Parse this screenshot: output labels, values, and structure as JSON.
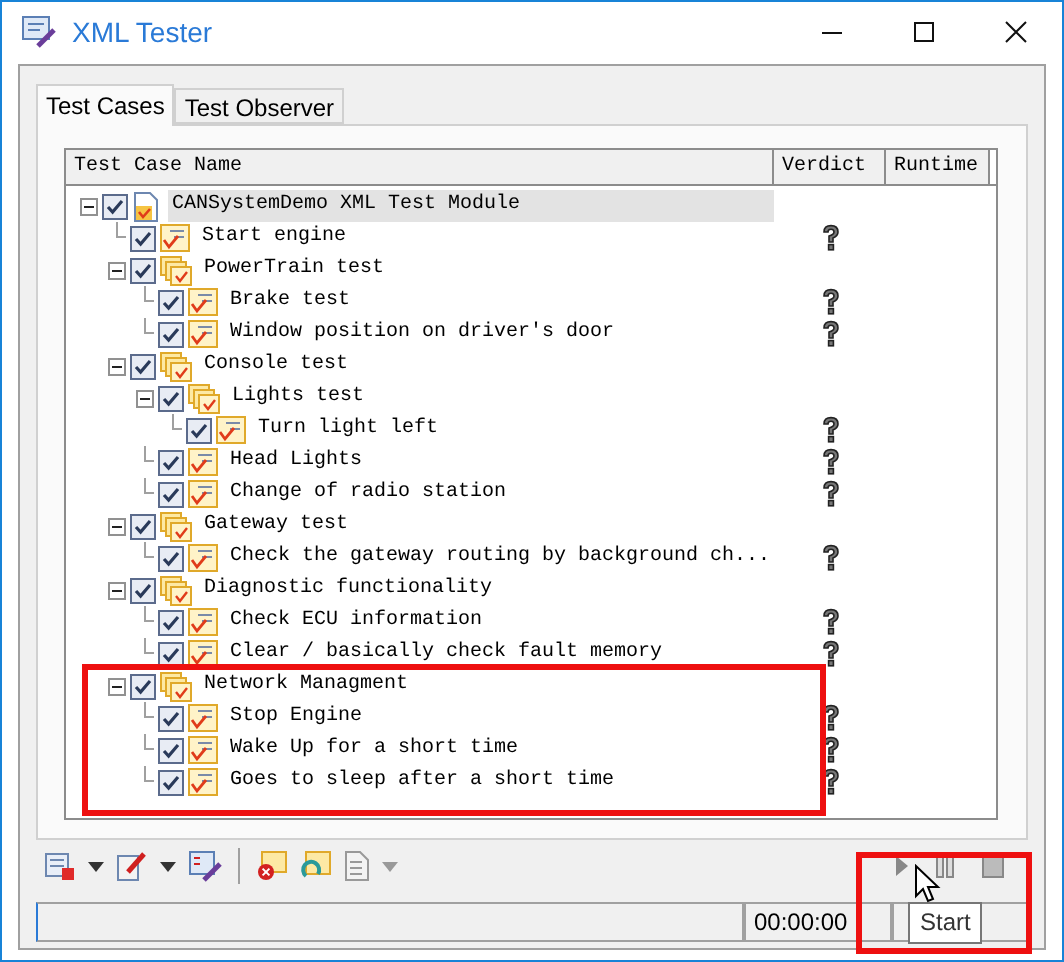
{
  "window": {
    "title": "XML Tester"
  },
  "tabs": [
    {
      "label": "Test Cases",
      "selected": true
    },
    {
      "label": "Test Observer",
      "selected": false
    }
  ],
  "test_tree": {
    "columns": [
      "Test Case Name",
      "Verdict",
      "Runtime"
    ],
    "items": [
      {
        "kind": "module",
        "label": "CANSystemDemo XML Test Module",
        "checked": true,
        "expanded": true,
        "selected": true,
        "children": [
          {
            "kind": "test",
            "label": "Start engine",
            "checked": true
          },
          {
            "kind": "group",
            "label": "PowerTrain test",
            "checked": true,
            "expanded": true,
            "children": [
              {
                "kind": "test",
                "label": "Brake test",
                "checked": true
              },
              {
                "kind": "test",
                "label": "Window position on driver's door",
                "checked": true
              }
            ]
          },
          {
            "kind": "group",
            "label": "Console test",
            "checked": true,
            "expanded": true,
            "children": [
              {
                "kind": "group",
                "label": "Lights test",
                "checked": true,
                "expanded": true,
                "children": [
                  {
                    "kind": "test",
                    "label": "Turn light left",
                    "checked": true
                  }
                ]
              },
              {
                "kind": "test",
                "label": "Head Lights",
                "checked": true
              },
              {
                "kind": "test",
                "label": "Change of radio station",
                "checked": true
              }
            ]
          },
          {
            "kind": "group",
            "label": "Gateway test",
            "checked": true,
            "expanded": true,
            "children": [
              {
                "kind": "test",
                "label": "Check the gateway routing by background ch...",
                "checked": true
              }
            ]
          },
          {
            "kind": "group",
            "label": "Diagnostic functionality",
            "checked": true,
            "expanded": true,
            "children": [
              {
                "kind": "test",
                "label": "Check ECU information",
                "checked": true
              },
              {
                "kind": "test",
                "label": "Clear / basically check fault memory",
                "checked": true
              }
            ]
          },
          {
            "kind": "group",
            "label": "Network Managment",
            "checked": true,
            "expanded": true,
            "children": [
              {
                "kind": "test",
                "label": "Stop Engine",
                "checked": true
              },
              {
                "kind": "test",
                "label": "Wake Up for a short time",
                "checked": true
              },
              {
                "kind": "test",
                "label": "Goes to sleep after a short time",
                "checked": true
              }
            ]
          }
        ]
      }
    ]
  },
  "status_bar": {
    "time": "00:00:00"
  },
  "tooltip": {
    "text": "Start"
  }
}
